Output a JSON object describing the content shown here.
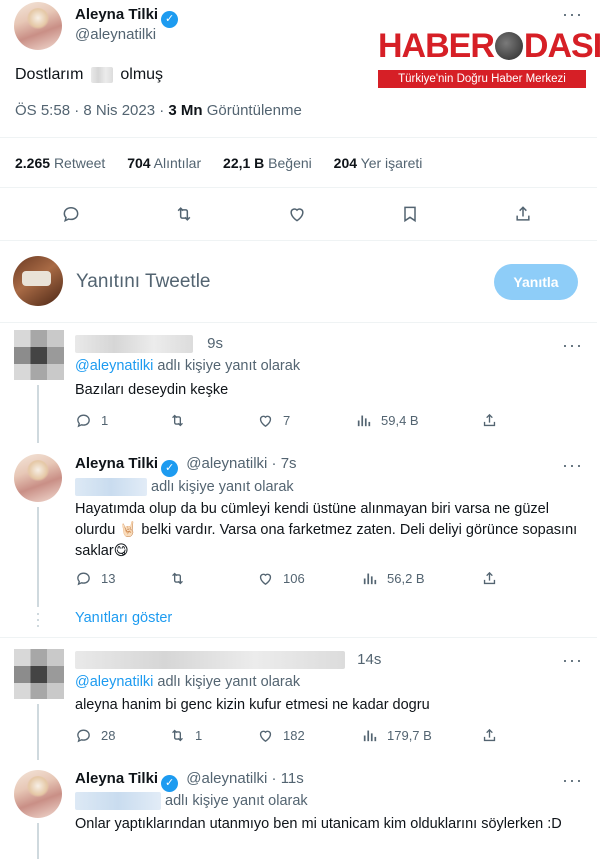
{
  "main_tweet": {
    "author_name": "Aleyna Tilki",
    "author_handle": "@aleynatilki",
    "text_before": "Dostlarım",
    "text_after": "olmuş",
    "time": "ÖS 5:58 · 8 Nis 2023 · ",
    "views": "3 Mn",
    "views_label": " Görüntülenme"
  },
  "stats": [
    {
      "value": "2.265",
      "label": "Retweet"
    },
    {
      "value": "704",
      "label": "Alıntılar"
    },
    {
      "value": "22,1 B",
      "label": "Beğeni"
    },
    {
      "value": "204",
      "label": "Yer işareti"
    }
  ],
  "icons": [
    "reply-icon",
    "retweet-icon",
    "like-icon",
    "bookmark-icon",
    "share-icon"
  ],
  "composer": {
    "placeholder": "Yanıtını Tweetle",
    "button": "Yanıtla"
  },
  "replies": [
    {
      "time": "9s",
      "replying_mention": "@aleynatilki",
      "replying_label": " adlı kişiye yanıt olarak",
      "text": "Bazıları deseydin keşke",
      "replies": "1",
      "retweets": "",
      "likes": "7",
      "views": "59,4 B"
    },
    {
      "name": "Aleyna Tilki",
      "handle": "@aleynatilki",
      "time": "· 7s",
      "replying_label": "adlı kişiye yanıt olarak",
      "text": "Hayatımda olup da bu cümleyi kendi üstüne alınmayan biri varsa ne güzel olurdu 🤘🏻 belki vardır. Varsa ona farketmez zaten. Deli deliyi görünce sopasını saklar😋",
      "replies": "13",
      "retweets": "",
      "likes": "106",
      "views": "56,2 B",
      "show_replies": "Yanıtları göster"
    },
    {
      "time": "14s",
      "replying_mention": "@aleynatilki",
      "replying_label": " adlı kişiye yanıt olarak",
      "text": "aleyna hanim bi genc kizin kufur etmesi ne kadar dogru",
      "replies": "28",
      "retweets": "1",
      "likes": "182",
      "views": "179,7 B"
    },
    {
      "name": "Aleyna Tilki",
      "handle": "@aleynatilki",
      "time": "· 11s",
      "replying_label": "adlı kişiye yanıt olarak",
      "text": "Onlar yaptıklarından utanmıyo ben mi utanicam kim olduklarını söylerken :D"
    }
  ],
  "watermark": {
    "logo_left": "HABER",
    "logo_right": "DASI",
    "tagline": "Türkiye'nin Doğru Haber Merkezi"
  },
  "colors": {
    "accent": "#1d9bf0",
    "secondary_text": "#536471",
    "reply_button": "#8ecdf8",
    "watermark_red": "#d61f26"
  }
}
